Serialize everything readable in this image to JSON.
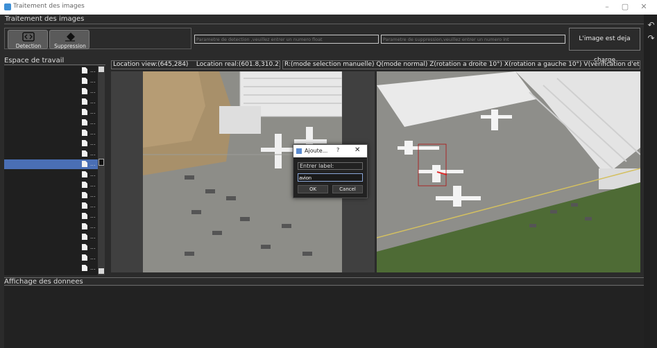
{
  "window": {
    "title": "Traitement des images"
  },
  "section": {
    "title": "Traitement des images"
  },
  "toolbar": {
    "detection_label": "Detection",
    "suppression_label": "Suppression",
    "detection_placeholder": "Parametre de detection ,veuillez entrer un numero float",
    "suppression_placeholder": "Parametre de suppression,veuillez entrer un numero int",
    "status": "L'image est deja charge"
  },
  "workspace": {
    "title": "Espace de travail",
    "file_count": 20,
    "selected_index": 9,
    "item_suffix": "..."
  },
  "infobar": {
    "location_view": "Location view:(645,284)",
    "location_real": "Location real:(601.8,310.2)",
    "shortcuts": "R:(mode selection manuelle) Q(mode normal) Z(rotation a droite 10°) X(rotation a gauche 10°) V(verification d'etiquetage"
  },
  "data_section": {
    "title": "Affichage des donnees"
  },
  "dialog": {
    "title": "Ajoute...",
    "help": "?",
    "close": "✕",
    "label": "Entrer label:",
    "value": "avion",
    "ok": "OK",
    "cancel": "Cancel"
  },
  "right_toolbar": {
    "undo_icon": "↶",
    "redo_icon": "↷"
  },
  "colors": {
    "selection": "#4a6fb5",
    "background": "#2b2b2b",
    "tarmac": "#8e8e8a",
    "grass": "#4e6b35"
  }
}
